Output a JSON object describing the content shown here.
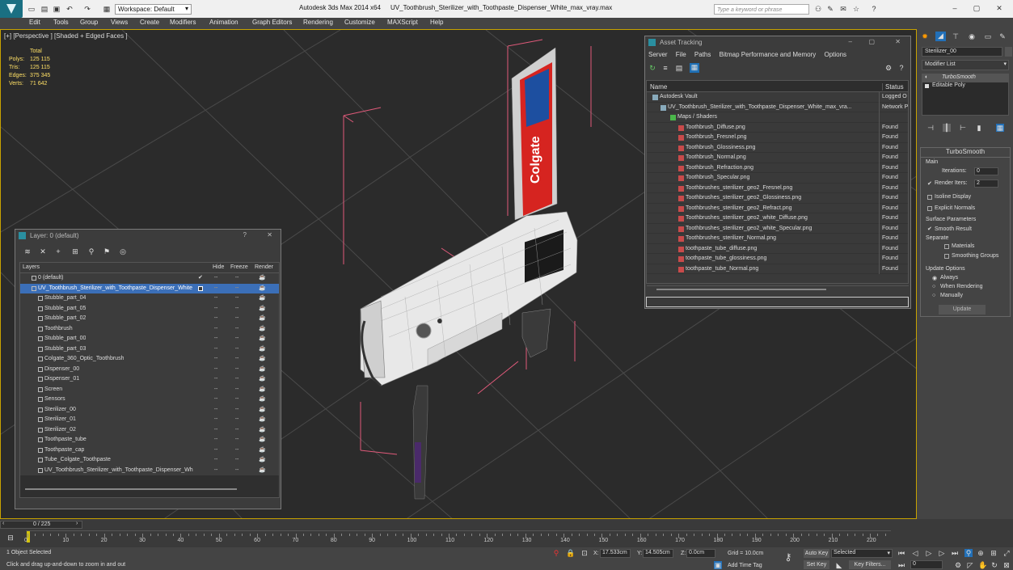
{
  "titlebar": {
    "workspace_label": "Workspace: Default",
    "app_title": "Autodesk 3ds Max  2014 x64",
    "file_title": "UV_Toothbrush_Sterilizer_with_Toothpaste_Dispenser_White_max_vray.max",
    "search_placeholder": "Type a keyword or phrase"
  },
  "menubar": {
    "items": [
      "Edit",
      "Tools",
      "Group",
      "Views",
      "Create",
      "Modifiers",
      "Animation",
      "Graph Editors",
      "Rendering",
      "Customize",
      "MAXScript",
      "Help"
    ]
  },
  "viewport": {
    "label": "[+] [Perspective ] [Shaded + Edged Faces ]",
    "stats_header": "Total",
    "stats": [
      {
        "label": "Polys:",
        "value": "125 115"
      },
      {
        "label": "Tris:",
        "value": "125 115"
      },
      {
        "label": "Edges:",
        "value": "375 345"
      },
      {
        "label": "Verts:",
        "value": "71 642"
      }
    ],
    "tube_brand": "Colgate"
  },
  "asset_tracking": {
    "title": "Asset Tracking",
    "menu": [
      "Server",
      "File",
      "Paths",
      "Bitmap Performance and Memory",
      "Options"
    ],
    "columns": [
      "Name",
      "Status"
    ],
    "rows": [
      {
        "name": "Autodesk Vault",
        "status": "Logged O",
        "level": 1
      },
      {
        "name": "UV_Toothbrush_Sterilizer_with_Toothpaste_Dispenser_White_max_vra...",
        "status": "Network P",
        "level": 2
      },
      {
        "name": "Maps / Shaders",
        "status": "",
        "level": 3
      },
      {
        "name": "Toothbrush_Diffuse.png",
        "status": "Found",
        "level": 4
      },
      {
        "name": "Toothbrush_Fresnel.png",
        "status": "Found",
        "level": 4
      },
      {
        "name": "Toothbrush_Glossiness.png",
        "status": "Found",
        "level": 4
      },
      {
        "name": "Toothbrush_Normal.png",
        "status": "Found",
        "level": 4
      },
      {
        "name": "Toothbrush_Refraction.png",
        "status": "Found",
        "level": 4
      },
      {
        "name": "Toothbrush_Specular.png",
        "status": "Found",
        "level": 4
      },
      {
        "name": "Toothbrushes_sterilizer_geo2_Fresnel.png",
        "status": "Found",
        "level": 4
      },
      {
        "name": "Toothbrushes_sterilizer_geo2_Glossiness.png",
        "status": "Found",
        "level": 4
      },
      {
        "name": "Toothbrushes_sterilizer_geo2_Refract.png",
        "status": "Found",
        "level": 4
      },
      {
        "name": "Toothbrushes_sterilizer_geo2_white_Diffuse.png",
        "status": "Found",
        "level": 4
      },
      {
        "name": "Toothbrushes_sterilizer_geo2_white_Specular.png",
        "status": "Found",
        "level": 4
      },
      {
        "name": "Toothbrushes_sterilizer_Normal.png",
        "status": "Found",
        "level": 4
      },
      {
        "name": "toothpaste_tube_diffuse.png",
        "status": "Found",
        "level": 4
      },
      {
        "name": "toothpaste_tube_glossiness.png",
        "status": "Found",
        "level": 4
      },
      {
        "name": "toothpaste_tube_Normal.png",
        "status": "Found",
        "level": 4
      }
    ]
  },
  "layers": {
    "title": "Layer: 0 (default)",
    "columns": [
      "Layers",
      "Hide",
      "Freeze",
      "Render"
    ],
    "rows": [
      {
        "name": "0 (default)",
        "level": 1,
        "selected": false,
        "check": true
      },
      {
        "name": "UV_Toothbrush_Sterilizer_with_Toothpaste_Dispenser_White",
        "level": 1,
        "selected": true,
        "check": false
      },
      {
        "name": "Stubble_part_04",
        "level": 2
      },
      {
        "name": "Stubble_part_05",
        "level": 2
      },
      {
        "name": "Stubble_part_02",
        "level": 2
      },
      {
        "name": "Toothbrush",
        "level": 2
      },
      {
        "name": "Stubble_part_00",
        "level": 2
      },
      {
        "name": "Stubble_part_03",
        "level": 2
      },
      {
        "name": "Colgate_360_Optic_Toothbrush",
        "level": 2
      },
      {
        "name": "Dispenser_00",
        "level": 2
      },
      {
        "name": "Dispenser_01",
        "level": 2
      },
      {
        "name": "Screen",
        "level": 2
      },
      {
        "name": "Sensors",
        "level": 2
      },
      {
        "name": "Sterilizer_00",
        "level": 2
      },
      {
        "name": "Sterilizer_01",
        "level": 2
      },
      {
        "name": "Sterilizer_02",
        "level": 2
      },
      {
        "name": "Toothpaste_tube",
        "level": 2
      },
      {
        "name": "Toothpaste_cap",
        "level": 2
      },
      {
        "name": "Tube_Colgate_Toothpaste",
        "level": 2
      },
      {
        "name": "UV_Toothbrush_Sterilizer_with_Toothpaste_Dispenser_Wh",
        "level": 2
      }
    ]
  },
  "command_panel": {
    "object_name": "Sterilizer_00",
    "modifier_list": "Modifier List",
    "stack": [
      "TurboSmooth",
      "Editable Poly"
    ],
    "rollout_title": "TurboSmooth",
    "main_label": "Main",
    "iterations_label": "Iterations:",
    "iterations_value": "0",
    "render_iters_label": "Render Iters:",
    "render_iters_value": "2",
    "isoline_label": "Isoline Display",
    "explicit_label": "Explicit Normals",
    "surface_label": "Surface Parameters",
    "smooth_result_label": "Smooth Result",
    "separate_label": "Separate",
    "materials_label": "Materials",
    "smoothing_groups_label": "Smoothing Groups",
    "update_options_label": "Update Options",
    "always_label": "Always",
    "when_rendering_label": "When Rendering",
    "manually_label": "Manually",
    "update_button": "Update"
  },
  "timeline": {
    "frame_label": "0 / 225",
    "ticks": [
      "0",
      "10",
      "20",
      "30",
      "40",
      "50",
      "60",
      "70",
      "80",
      "90",
      "100",
      "110",
      "120",
      "130",
      "140",
      "150",
      "160",
      "170",
      "180",
      "190",
      "200",
      "210",
      "220"
    ]
  },
  "statusbar": {
    "selection": "1 Object Selected",
    "prompt": "Click and drag up-and-down to zoom in and out",
    "x_label": "X:",
    "x_value": "17.533cm",
    "y_label": "Y:",
    "y_value": "14.505cm",
    "z_label": "Z:",
    "z_value": "0.0cm",
    "grid": "Grid = 10.0cm",
    "auto_key": "Auto Key",
    "selected_dropdown": "Selected",
    "set_key": "Set Key",
    "key_filters": "Key Filters...",
    "add_time_tag": "Add Time Tag",
    "frame_value": "0"
  }
}
